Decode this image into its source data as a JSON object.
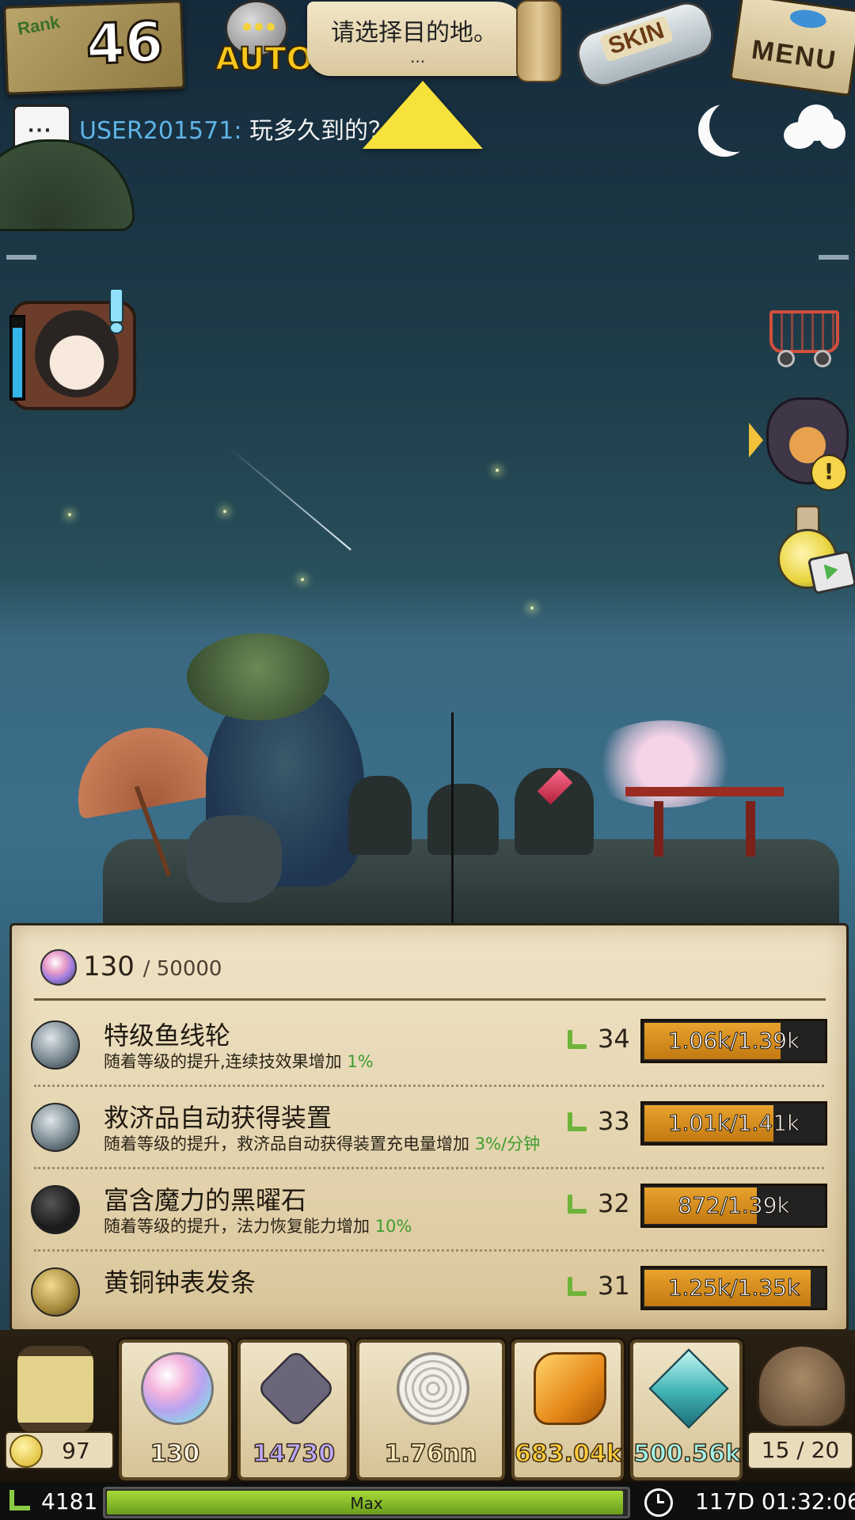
{
  "header": {
    "rank_label": "Rank",
    "rank_value": "46",
    "auto_label": "AUTO",
    "destination_text": "请选择目的地。",
    "destination_dots": "...",
    "skin_label": "SKIN",
    "menu_label": "MENU"
  },
  "chat": {
    "user": "USER201571:",
    "message": "玩多久到的？"
  },
  "panel": {
    "orb_current": "130",
    "orb_max": "/ 50000",
    "rows": [
      {
        "icon": "fishing-reel-icon",
        "name": "特级鱼线轮",
        "desc": "随着等级的提升,连续技效果增加",
        "pct": "1%",
        "level": "34",
        "xp": "1.06k/1.39k",
        "xp_fraction": 0.76
      },
      {
        "icon": "auto-supply-device-icon",
        "name": "救济品自动获得装置",
        "desc": "随着等级的提升，救济品自动获得装置充电量增加",
        "pct": "3%/分钟",
        "level": "33",
        "xp": "1.01k/1.41k",
        "xp_fraction": 0.72
      },
      {
        "icon": "obsidian-icon",
        "name": "富含魔力的黑曜石",
        "desc": "随着等级的提升，法力恢复能力增加",
        "pct": "10%",
        "level": "32",
        "xp": "872/1.39k",
        "xp_fraction": 0.63
      },
      {
        "icon": "brass-clock-spring-icon",
        "name": "黄铜钟表发条",
        "desc": "",
        "pct": "",
        "level": "31",
        "xp": "1.25k/1.35k",
        "xp_fraction": 0.93
      }
    ]
  },
  "inventory": {
    "left_counter": "97",
    "resources": [
      {
        "icon": "rainbow-orb-icon",
        "value": "130",
        "color": "#f7f1df"
      },
      {
        "icon": "skull-shield-icon",
        "value": "14730",
        "color": "#b9a8ff"
      },
      {
        "icon": "shell-icon",
        "value": "1.76nn",
        "color": "#f3e7b8"
      },
      {
        "icon": "amber-icon",
        "value": "683.04k",
        "color": "#ffcc3a"
      },
      {
        "icon": "diamond-icon",
        "value": "500.56k",
        "color": "#9ff0e8"
      }
    ],
    "right_counter": "15 / 20"
  },
  "status": {
    "level": "4181",
    "exp_label": "Max",
    "exp_fraction": 1.0,
    "time": "117D 01:32:06"
  },
  "colors": {
    "accent_gold": "#f6e23a",
    "xp_orange": "#e8a22d",
    "pct_green": "#3f9c2e",
    "chat_user_blue": "#5fb3e6"
  }
}
